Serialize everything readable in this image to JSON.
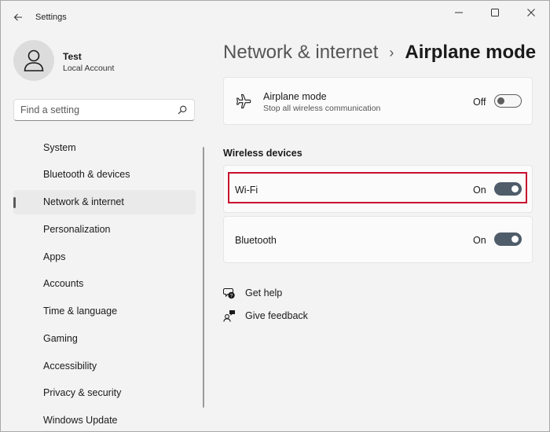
{
  "window": {
    "title": "Settings",
    "back_icon": "back-arrow-icon",
    "controls": [
      "minimize-icon",
      "maximize-icon",
      "close-icon"
    ]
  },
  "profile": {
    "name": "Test",
    "account_type": "Local Account",
    "avatar_icon": "person-icon"
  },
  "search": {
    "placeholder": "Find a setting",
    "icon": "search-icon"
  },
  "sidebar": {
    "items": [
      {
        "label": "System",
        "active": false
      },
      {
        "label": "Bluetooth & devices",
        "active": false
      },
      {
        "label": "Network & internet",
        "active": true
      },
      {
        "label": "Personalization",
        "active": false
      },
      {
        "label": "Apps",
        "active": false
      },
      {
        "label": "Accounts",
        "active": false
      },
      {
        "label": "Time & language",
        "active": false
      },
      {
        "label": "Gaming",
        "active": false
      },
      {
        "label": "Accessibility",
        "active": false
      },
      {
        "label": "Privacy & security",
        "active": false
      },
      {
        "label": "Windows Update",
        "active": false
      }
    ]
  },
  "breadcrumb": {
    "parent": "Network & internet",
    "separator": "›",
    "current": "Airplane mode"
  },
  "airplane": {
    "title": "Airplane mode",
    "subtitle": "Stop all wireless communication",
    "state": "Off",
    "on": false,
    "icon": "airplane-icon"
  },
  "wireless": {
    "heading": "Wireless devices",
    "wifi": {
      "label": "Wi-Fi",
      "state": "On",
      "on": true
    },
    "bluetooth": {
      "label": "Bluetooth",
      "state": "On",
      "on": true
    }
  },
  "help": {
    "get_help": "Get help",
    "give_feedback": "Give feedback"
  },
  "colors": {
    "toggle_on": "#4f5c6a",
    "highlight": "#c8102e",
    "window_bg": "#f3f3f3",
    "card_bg": "#fbfbfb"
  }
}
